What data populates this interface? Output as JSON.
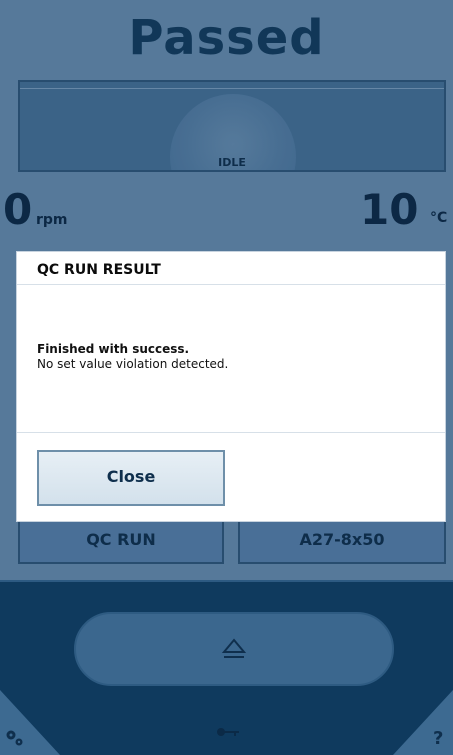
{
  "status": {
    "title": "Passed"
  },
  "rotor": {
    "status": "IDLE"
  },
  "readings": {
    "speed_value": "0",
    "speed_unit": "rpm",
    "temperature_value": "10",
    "temperature_unit": "°C"
  },
  "tiles": {
    "program": "QC RUN",
    "rotor": "A27-8x50"
  },
  "dialog": {
    "title": "QC RUN RESULT",
    "heading": "Finished with success.",
    "message": "No set value violation detected.",
    "close_label": "Close"
  },
  "footer": {
    "help": "?"
  },
  "icons": {
    "eject": "eject-icon",
    "settings": "gears-icon",
    "key": "key-icon",
    "help": "help-icon"
  },
  "colors": {
    "background": "#5d82a3",
    "title": "#123a5c",
    "bottom_band": "#0f3a5e",
    "dialog_bg": "#ffffff",
    "button": "#d3e1ec"
  }
}
